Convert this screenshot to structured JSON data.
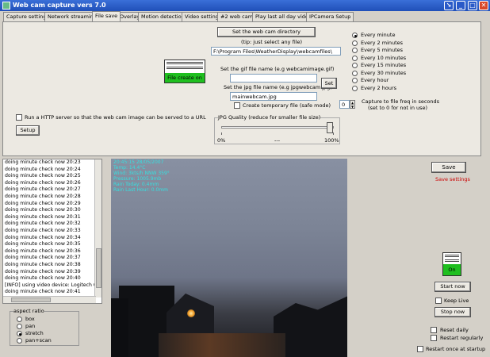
{
  "window": {
    "title": "Web cam capture vers 7.0"
  },
  "tabs": [
    "Capture settings",
    "Network streaming",
    "File save",
    "Overlay",
    "Motion detection",
    "Video settings",
    "#2 web cam",
    "Play last all day video",
    "IPCamera Setup"
  ],
  "file_save": {
    "set_dir_button": "Set the web cam directory",
    "tip": "(tip: just select any file)",
    "dir_path": "F:\\Program Files\\WeatherDisplay\\webcamfiles\\",
    "file_create_status": "File create on",
    "gif_label": "Set the gif file name (e.g webcamimage.gif)",
    "gif_value": "",
    "jpg_label": "Set the jpg file name (e.g jpgwebcam.jpg)",
    "jpg_value": "mainwebcam.jpg",
    "set_button": "Set",
    "temp_file_label": "Create temporary file (safe mode)",
    "http_label": "Run a HTTP server so that the web cam image can be served to a URL",
    "setup_button": "Setup",
    "jpg_quality_label": "JPG Quality  (reduce for smaller file size)",
    "quality_min": "0%",
    "quality_mid": "---",
    "quality_max": "100%",
    "quality_fraction": 0.97,
    "freq_value": "0",
    "freq_label_1": "Capture to file freq in seconds",
    "freq_label_2": "(set to 0 for not in use)",
    "intervals": [
      "Every minute",
      "Every 2 minutes",
      "Every 5 minutes",
      "Every 10 minutes",
      "Every 15 minutes",
      "Every 30 minutes",
      "Every hour",
      "Every 2 hours"
    ],
    "selected_interval": 0
  },
  "log_lines": [
    "doing minute check now 20:23",
    "doing minute check now 20:24",
    "doing minute check now 20:25",
    "doing minute check now 20:26",
    "doing minute check now 20:27",
    "doing minute check now 20:28",
    "doing minute check now 20:29",
    "doing minute check now 20:30",
    "doing minute check now 20:31",
    "doing minute check now 20:32",
    "doing minute check now 20:33",
    "doing minute check now 20:34",
    "doing minute check now 20:35",
    "doing minute check now 20:36",
    "doing minute check now 20:37",
    "doing minute check now 20:38",
    "doing minute check now 20:39",
    "doing minute check now 20:40",
    "[INFO] using video device: Logitech Qu",
    "doing minute check now 20:41"
  ],
  "aspect": {
    "title": "aspect ratio",
    "options": [
      "box",
      "pan",
      "stretch",
      "pan+scan"
    ],
    "selected": 2
  },
  "overlay": {
    "lines": [
      "20:45:15 28/05/2007",
      "Temp: 14.4°C",
      "Wind: 3kts/h NNW 359°",
      "Pressure: 1005.9mb",
      "Rain Today: 0.4mm",
      "Rain Last Hour: 0.0mm"
    ]
  },
  "right": {
    "save_button": "Save",
    "save_settings": "Save settings",
    "on_status": "On",
    "start_button": "Start now",
    "keep_live": "Keep Live",
    "stop_button": "Stop now",
    "reset_daily": "Reset daily",
    "restart_regularly": "Restart regularly",
    "restart_startup": "Restart once at startup"
  },
  "colors": {
    "titlebar": "#245edb",
    "status_green": "#1fbf1f",
    "save_settings_text": "#cc0000",
    "overlay_text": "#35e0e0"
  }
}
